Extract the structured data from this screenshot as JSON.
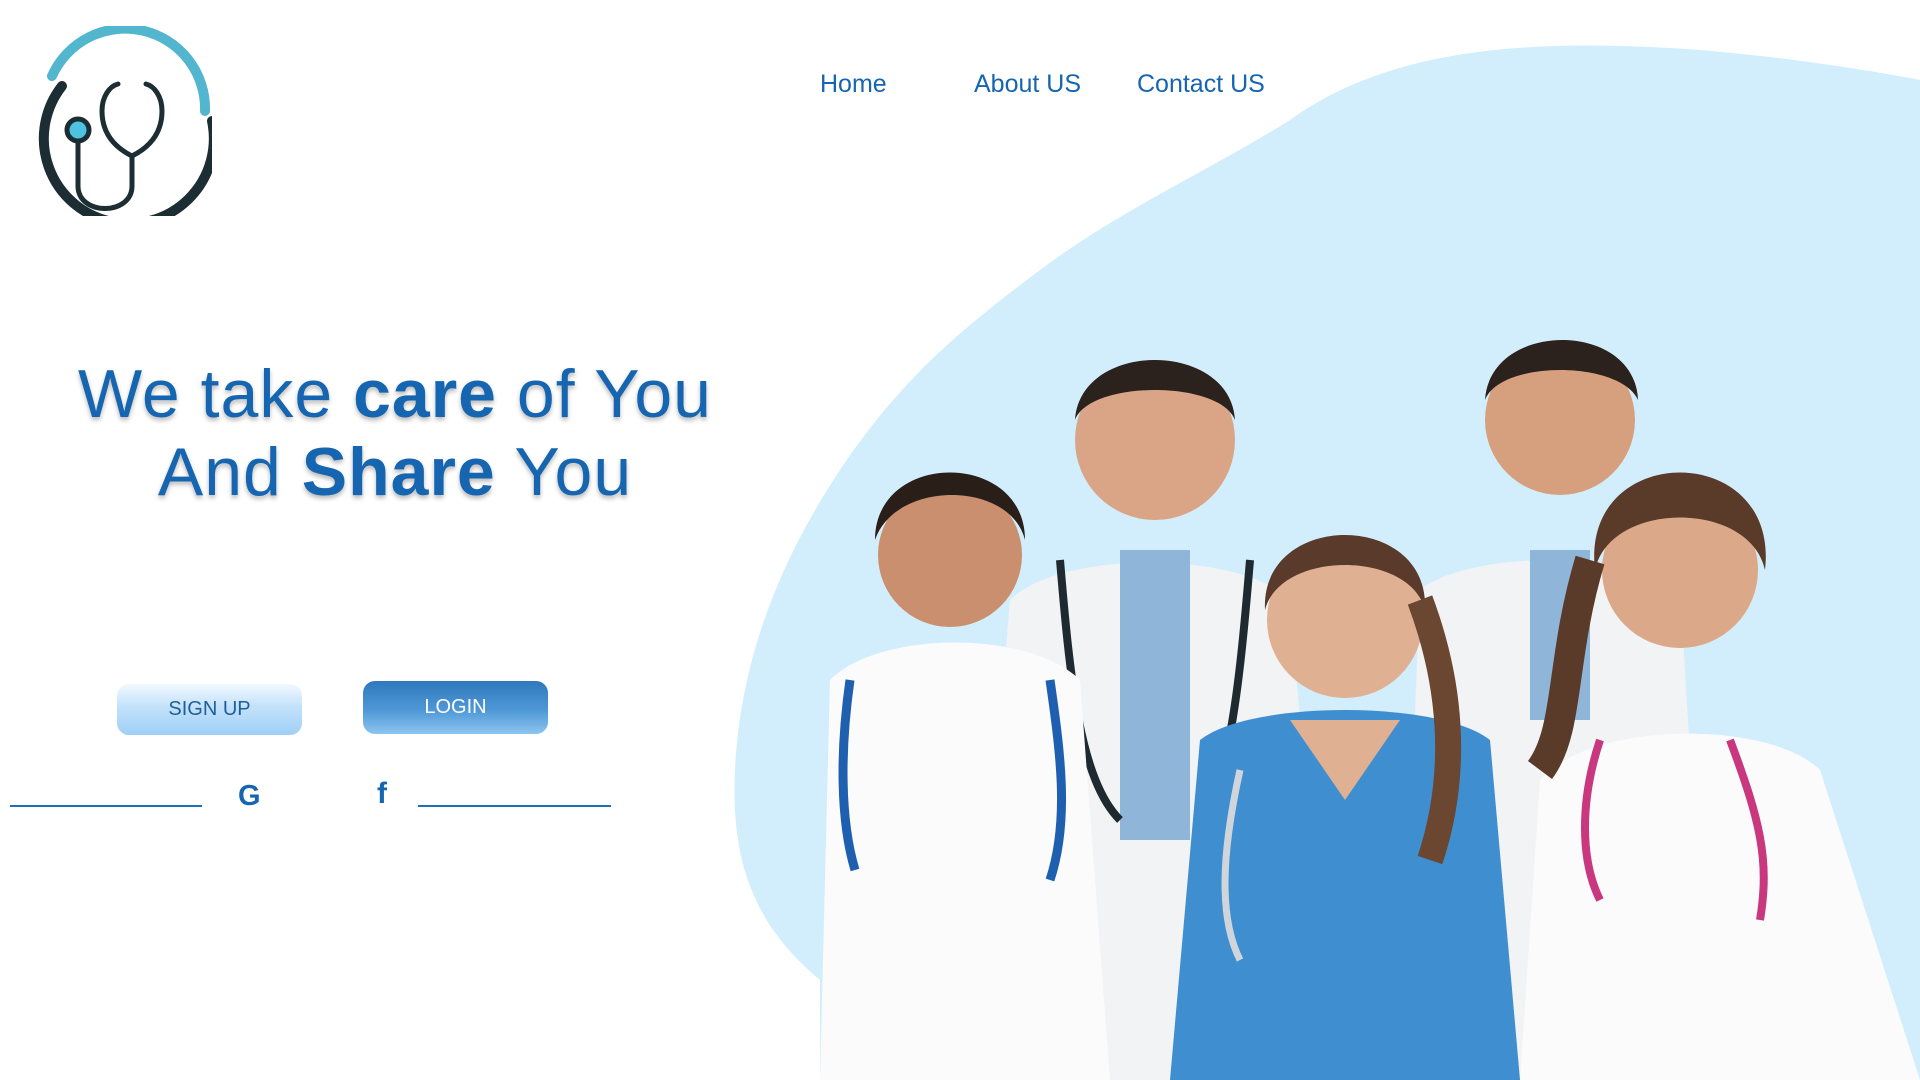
{
  "nav": {
    "home": "Home",
    "about": "About US",
    "contact": "Contact US"
  },
  "hero": {
    "line1_pre": "We take ",
    "line1_bold": "care",
    "line1_post": " of You",
    "line2_pre": "And ",
    "line2_bold": "Share",
    "line2_post": " You"
  },
  "actions": {
    "signup": "SIGN UP",
    "login": "LOGIN"
  },
  "social": {
    "google": "G",
    "facebook": "f"
  },
  "icons": {
    "logo": "stethoscope-logo-icon",
    "google": "google-icon",
    "facebook": "facebook-icon"
  },
  "colors": {
    "brand_blue": "#1565b0",
    "blob_bg": "#d2eefd",
    "login_bg": "#3f89cc",
    "signup_bg": "#b8dcfa"
  }
}
